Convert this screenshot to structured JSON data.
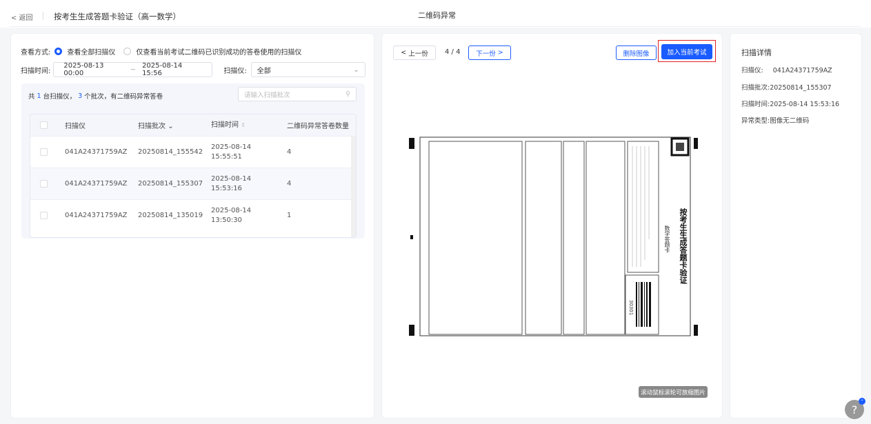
{
  "header": {
    "back_label": "< 返回",
    "page_title": "按考生生成答题卡验证（高一数学）",
    "center_title": "二维码异常"
  },
  "filters": {
    "view_mode_label": "查看方式:",
    "radio_all": "查看全部扫描仪",
    "radio_success": "仅查看当前考试二维码已识别成功的答卷使用的扫描仪",
    "time_label": "扫描时间:",
    "time_start": "2025-08-13 00:00",
    "time_sep": "~",
    "time_end": "2025-08-14 15:56",
    "scanner_label": "扫描仪:",
    "scanner_value": "全部"
  },
  "summary": {
    "p1": "共 ",
    "scanners": "1",
    "p2": " 台扫描仪， ",
    "batches": "3",
    "p3": " 个批次，有二维码异常答卷",
    "search_placeholder": "请输入扫描批次"
  },
  "table": {
    "headers": [
      "扫描仪",
      "扫描批次",
      "扫描时间",
      "二维码异常答卷数量"
    ],
    "rows": [
      {
        "scanner": "041A24371759AZ",
        "batch": "20250814_155542",
        "date": "2025-08-14",
        "time": "15:55:51",
        "count": "4"
      },
      {
        "scanner": "041A24371759AZ",
        "batch": "20250814_155307",
        "date": "2025-08-14",
        "time": "15:53:16",
        "count": "4"
      },
      {
        "scanner": "041A24371759AZ",
        "batch": "20250814_135019",
        "date": "2025-08-14",
        "time": "13:50:30",
        "count": "1"
      }
    ]
  },
  "viewer": {
    "prev": "上一份",
    "page": "4 / 4",
    "next": "下一份",
    "delete": "删除图像",
    "add": "加入当前考试",
    "tip": "滚动鼠标滚轮可放缩图片",
    "sheet": {
      "title": "按考生生成答题卡验证",
      "subtitle": "数学答题卡",
      "code": "30301"
    }
  },
  "details": {
    "title": "扫描详情",
    "items": [
      {
        "label": "扫描仪:",
        "value": "041A24371759AZ"
      },
      {
        "label": "扫描批次:",
        "value": "20250814_155307"
      },
      {
        "label": "扫描时间:",
        "value": "2025-08-14 15:53:16"
      },
      {
        "label": "异常类型:",
        "value": "图像无二维码"
      }
    ]
  },
  "help": "?",
  "colors": {
    "primary": "#1a5cff",
    "highlight": "#e02020"
  }
}
